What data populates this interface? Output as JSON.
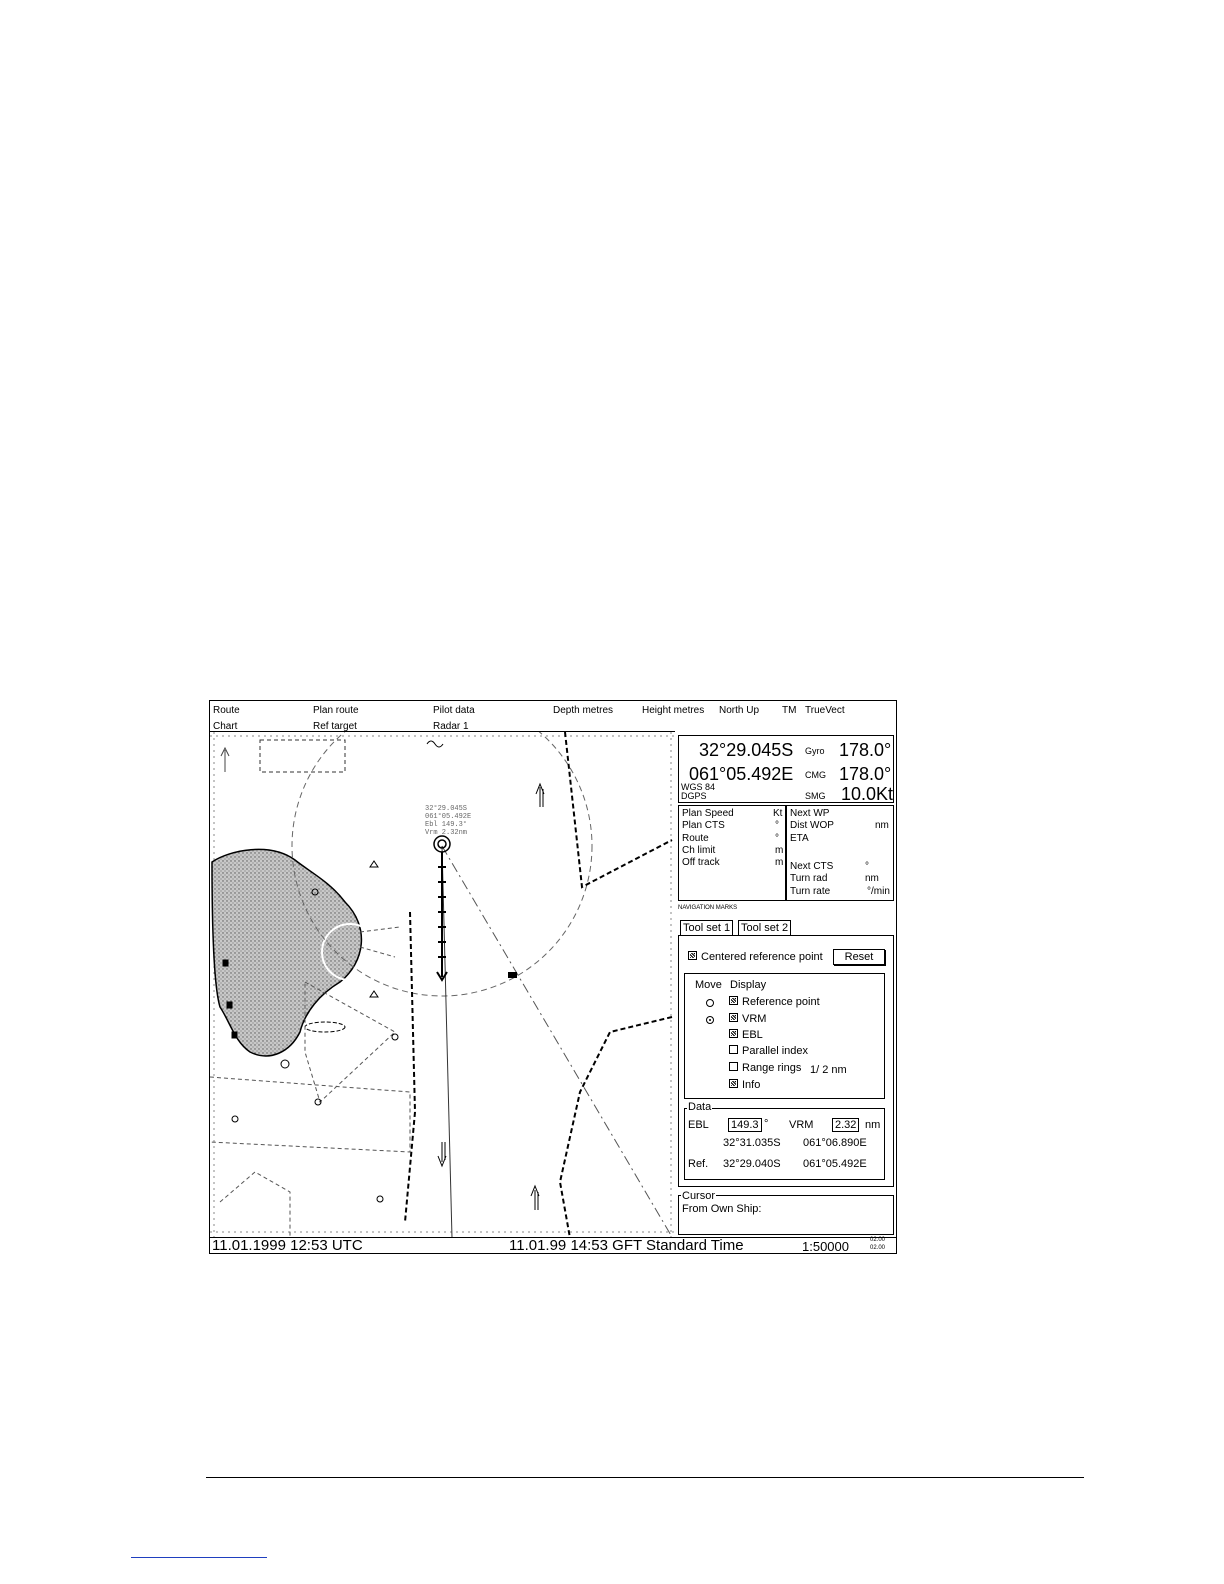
{
  "menu": {
    "row1": [
      "Route",
      "Plan route",
      "Pilot data",
      "Depth metres",
      "Height metres",
      "North Up",
      "TM",
      "TrueVect"
    ],
    "row2": [
      "Chart",
      "Ref target",
      "Radar  1"
    ]
  },
  "position": {
    "lat": "32°29.045S",
    "lon": "061°05.492E",
    "datum": "WGS 84",
    "source": "DGPS",
    "gyro_label": "Gyro",
    "gyro_value": "178.0°",
    "cmg_label": "CMG",
    "cmg_value": "178.0°",
    "smg_label": "SMG",
    "smg_value": "10.0Kt"
  },
  "route_info": {
    "left": [
      {
        "label": "Plan Speed",
        "unit": "Kt"
      },
      {
        "label": "Plan CTS",
        "unit": "°"
      },
      {
        "label": "Route",
        "unit": "°"
      },
      {
        "label": "Ch limit",
        "unit": "m"
      },
      {
        "label": "Off track",
        "unit": "m"
      }
    ],
    "right_top": [
      {
        "label": "Next WP",
        "unit": ""
      },
      {
        "label": "Dist WOP",
        "unit": "nm"
      },
      {
        "label": "ETA",
        "unit": ""
      }
    ],
    "right_bottom": [
      {
        "label": "Next CTS",
        "unit": "°"
      },
      {
        "label": "Turn rad",
        "unit": "nm"
      },
      {
        "label": "Turn rate",
        "unit": "°/min"
      }
    ]
  },
  "nav_marks": {
    "title": "NAVIGATION MARKS",
    "tabs": [
      "Tool set 1",
      "Tool set 2"
    ],
    "centered_label": "Centered reference point",
    "reset_label": "Reset",
    "move_header": "Move",
    "display_header": "Display",
    "items": [
      {
        "label": "Reference point",
        "checked": true,
        "move": "off"
      },
      {
        "label": "VRM",
        "checked": true,
        "move": "on"
      },
      {
        "label": "EBL",
        "checked": true,
        "move": ""
      },
      {
        "label": "Parallel index",
        "checked": false,
        "move": ""
      },
      {
        "label": "Range rings",
        "checked": false,
        "move": ""
      },
      {
        "label": "Info",
        "checked": true,
        "move": ""
      }
    ],
    "range_rings_value": "1/ 2 nm",
    "data_title": "Data",
    "ebl_label": "EBL",
    "ebl_value": "149.3",
    "ebl_unit": "°",
    "vrm_label": "VRM",
    "vrm_value": "2.32",
    "vrm_unit": "nm",
    "ebl_lat": "32°31.035S",
    "ebl_lon": "061°06.890E",
    "ref_label": "Ref.",
    "ref_lat": "32°29.040S",
    "ref_lon": "061°05.492E"
  },
  "cursor": {
    "title": "Cursor",
    "from": "From Own Ship:"
  },
  "chart_labels": {
    "info_lines": [
      "32°29.045S",
      "061°05.492E",
      "Ebl  149.3°",
      "Vrm  2.32nm"
    ]
  },
  "status": {
    "utc": "11.01.1999 12:53 UTC",
    "local": "11.01.99 14:53 GFT Standard Time",
    "scale": "1:50000",
    "small_1": "02.00",
    "small_2": "02.00"
  }
}
